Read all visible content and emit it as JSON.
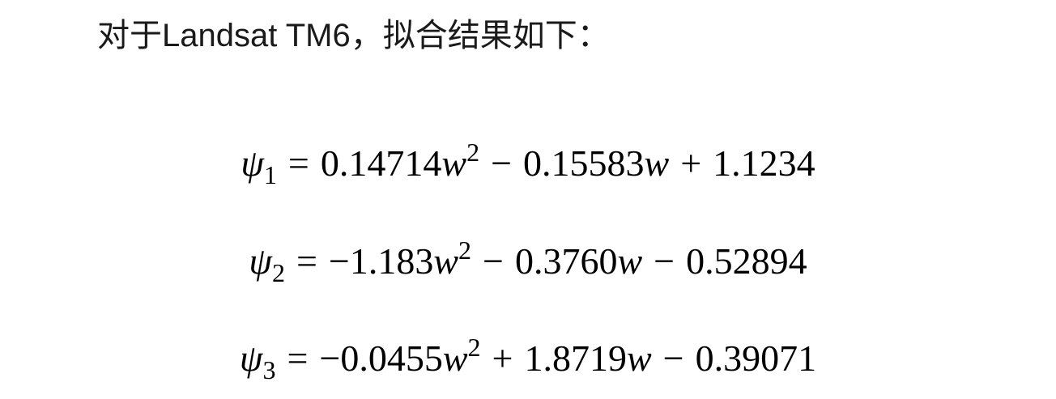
{
  "intro": {
    "text": "对于Landsat TM6，拟合结果如下："
  },
  "equations": [
    {
      "symbol": "ψ",
      "subscript": "1",
      "equals": "=",
      "terms": [
        {
          "coef": "0.14714",
          "var": "w",
          "power": "2"
        },
        {
          "op": "−",
          "coef": "0.15583",
          "var": "w",
          "power": ""
        },
        {
          "op": "+",
          "coef": "1.1234",
          "var": "",
          "power": ""
        }
      ]
    },
    {
      "symbol": "ψ",
      "subscript": "2",
      "equals": "=",
      "terms": [
        {
          "coef": "−1.183",
          "var": "w",
          "power": "2"
        },
        {
          "op": "−",
          "coef": "0.3760",
          "var": "w",
          "power": ""
        },
        {
          "op": "−",
          "coef": "0.52894",
          "var": "",
          "power": ""
        }
      ]
    },
    {
      "symbol": "ψ",
      "subscript": "3",
      "equals": "=",
      "terms": [
        {
          "coef": "−0.0455",
          "var": "w",
          "power": "2"
        },
        {
          "op": "+",
          "coef": "1.8719",
          "var": "w",
          "power": ""
        },
        {
          "op": "−",
          "coef": "0.39071",
          "var": "",
          "power": ""
        }
      ]
    }
  ]
}
